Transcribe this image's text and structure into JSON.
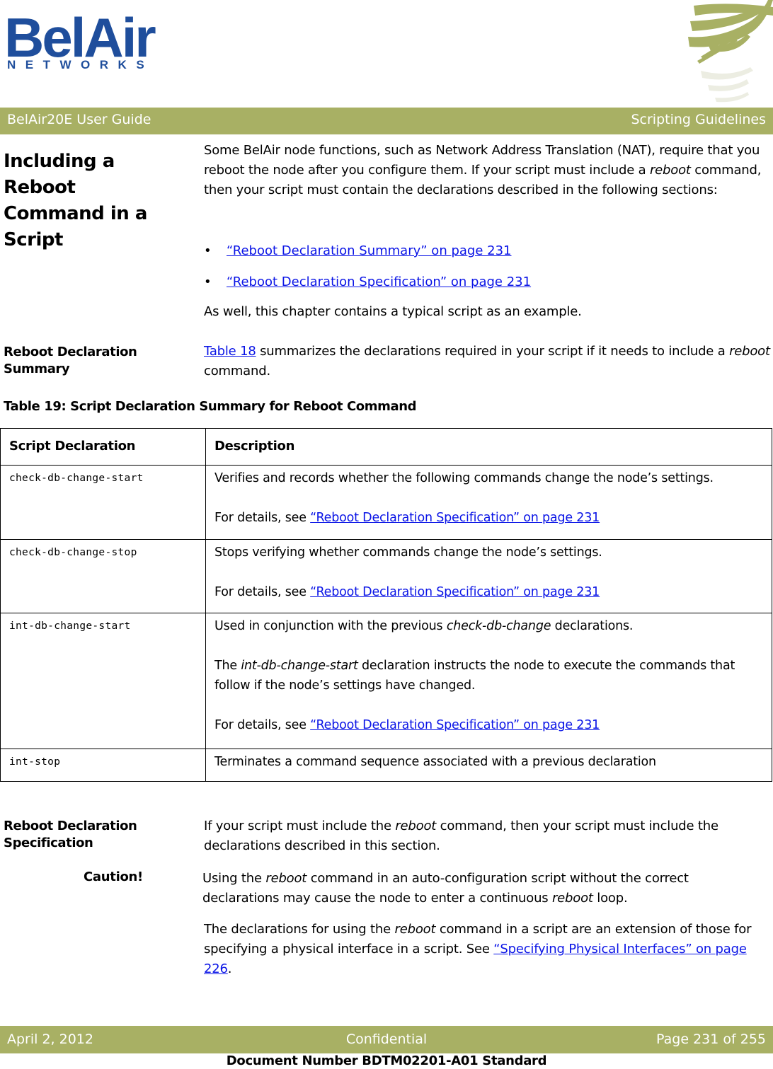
{
  "logo": {
    "word": "BelAir",
    "sub": "NETWORKS",
    "brand_color": "#1f4e9c",
    "swoosh_color": "#a8b064"
  },
  "header": {
    "left": "BelAir20E User Guide",
    "right": "Scripting Guidelines",
    "band_color": "#a8b064"
  },
  "section_reboot": {
    "heading": "Including a Reboot Command in a Script",
    "intro_1": "Some BelAir node functions, such as Network Address Translation (NAT), require that you reboot the node after you configure them. If your script must include a ",
    "intro_em": "reboot",
    "intro_2": " command, then your script must contain the declarations described in the following sections:",
    "bullets": [
      {
        "bullet": "•",
        "link": "“Reboot Declaration Summary” on page 231"
      },
      {
        "bullet": "•",
        "link": "“Reboot Declaration Specification” on page 231"
      }
    ],
    "outro": "As well, this chapter contains a typical script as an example."
  },
  "section_summary": {
    "heading": "Reboot Declaration Summary",
    "link": "Table 18",
    "text_1": " summarizes the declarations required in your script if it needs to include a ",
    "em": "reboot",
    "text_2": " command."
  },
  "table": {
    "title": "Table 19: Script Declaration Summary for Reboot Command",
    "headers": [
      "Script Declaration",
      "Description"
    ],
    "rows": [
      {
        "declaration": "check-db-change-start",
        "desc_1": "Verifies and records whether the following commands change the node’s settings.",
        "see_prefix": "For details, see ",
        "see_link": "“Reboot Declaration Specification” on page 231"
      },
      {
        "declaration": "check-db-change-stop",
        "desc_1": "Stops verifying whether commands change the node’s settings.",
        "see_prefix": "For details, see ",
        "see_link": "“Reboot Declaration Specification” on page 231"
      },
      {
        "declaration": "int-db-change-start",
        "desc_1a": "Used in conjunction with the previous ",
        "desc_1em": "check-db-change",
        "desc_1b": " declarations.",
        "desc_2a": "The ",
        "desc_2em": "int-db-change-start",
        "desc_2b": " declaration instructs the node to execute the commands that follow if the node’s settings have changed.",
        "see_prefix": "For details, see ",
        "see_link": "“Reboot Declaration Specification” on page 231"
      },
      {
        "declaration": "int-stop",
        "desc_1": "Terminates a command sequence associated with a previous declaration"
      }
    ]
  },
  "section_spec": {
    "heading": "Reboot Declaration Specification",
    "p1_a": "If your script must include the ",
    "p1_em": "reboot",
    "p1_b": " command, then your script must include the declarations described in this section.",
    "caution_label": "Caution!",
    "caution_a": "Using the ",
    "caution_em1": "reboot",
    "caution_b": " command in an auto-configuration script without the correct declarations may cause the node to enter a continuous ",
    "caution_em2": "reboot",
    "caution_c": " loop.",
    "p2_a": "The declarations for using the ",
    "p2_em": "reboot",
    "p2_b": " command in a script are an extension of those for specifying a physical interface in a script. See ",
    "p2_link": "“Specifying Physical Interfaces” on page 226",
    "p2_c": "."
  },
  "footer": {
    "date": "April 2, 2012",
    "classification": "Confidential",
    "page": "Page 231 of 255",
    "doc_number": "Document Number BDTM02201-A01 Standard"
  }
}
